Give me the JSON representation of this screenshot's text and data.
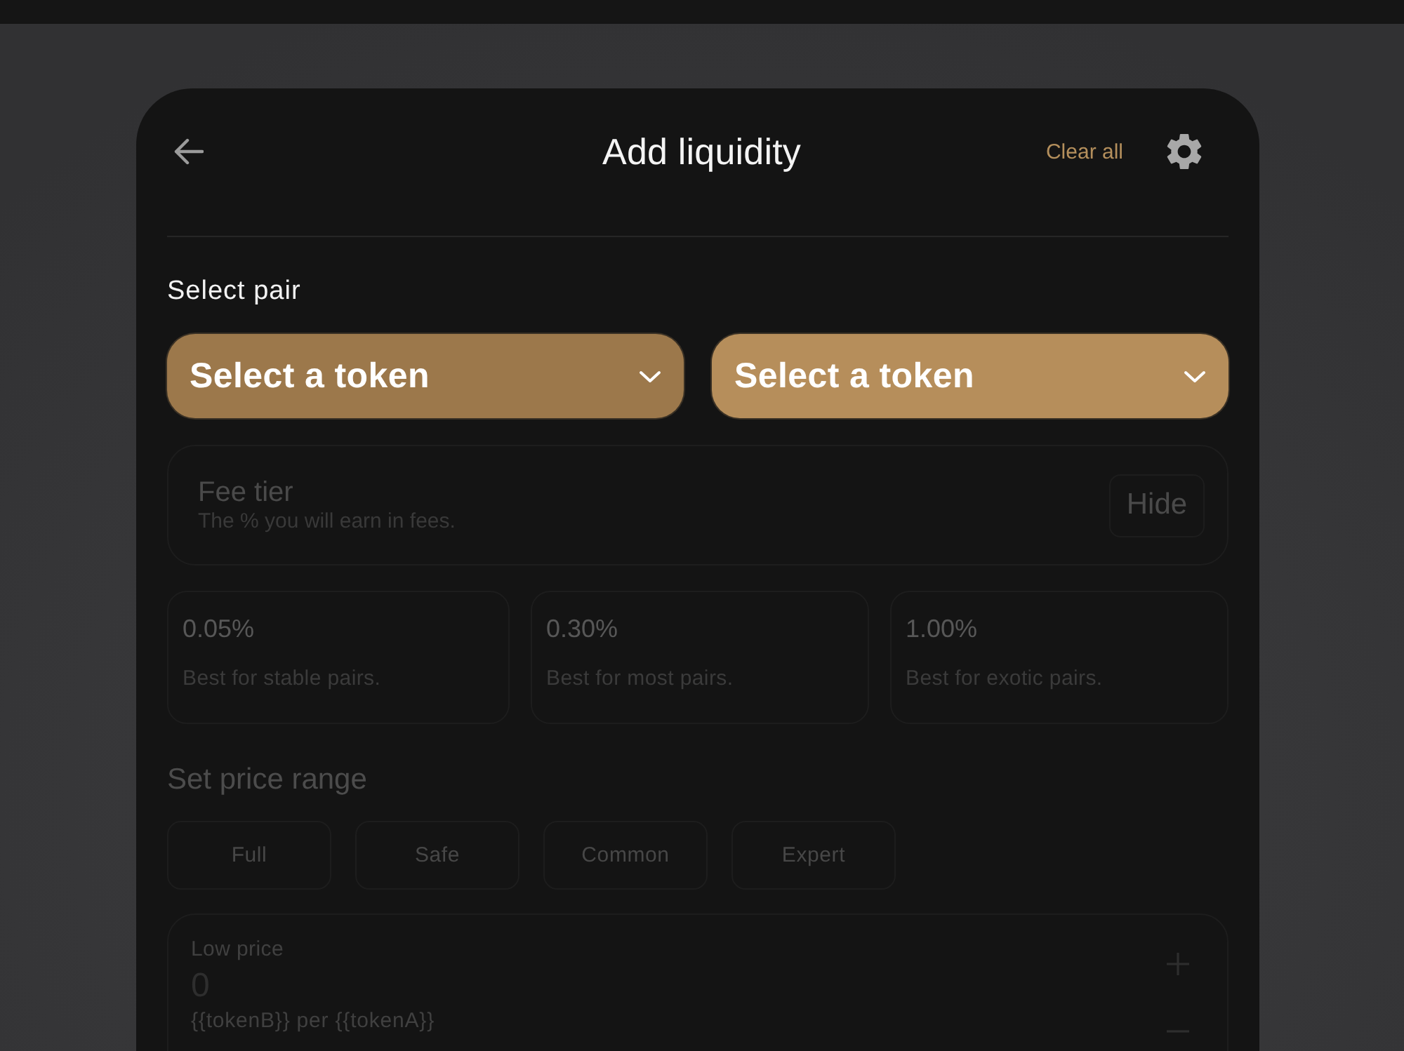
{
  "header": {
    "title": "Add liquidity",
    "clear_label": "Clear all"
  },
  "pair": {
    "label": "Select pair",
    "tokens": [
      {
        "label": "Select a token",
        "hovered": true
      },
      {
        "label": "Select a token",
        "hovered": false
      }
    ]
  },
  "fee_tier": {
    "title": "Fee tier",
    "subtitle": "The % you will earn in fees.",
    "toggle_label": "Hide",
    "disabled": true,
    "options": [
      {
        "value": "0.05%",
        "description": "Best for stable pairs.",
        "selected": false
      },
      {
        "value": "0.30%",
        "description": "Best for most pairs.",
        "selected": false
      },
      {
        "value": "1.00%",
        "description": "Best for exotic pairs.",
        "selected": false
      }
    ]
  },
  "price_range": {
    "title": "Set price range",
    "disabled": true,
    "presets": [
      {
        "label": "Full",
        "selected": false
      },
      {
        "label": "Safe",
        "selected": false
      },
      {
        "label": "Common",
        "selected": false
      },
      {
        "label": "Expert",
        "selected": false
      }
    ],
    "low_price": {
      "label": "Low price",
      "value": "0",
      "unit": "{{tokenB}} per {{tokenA}}"
    }
  }
}
